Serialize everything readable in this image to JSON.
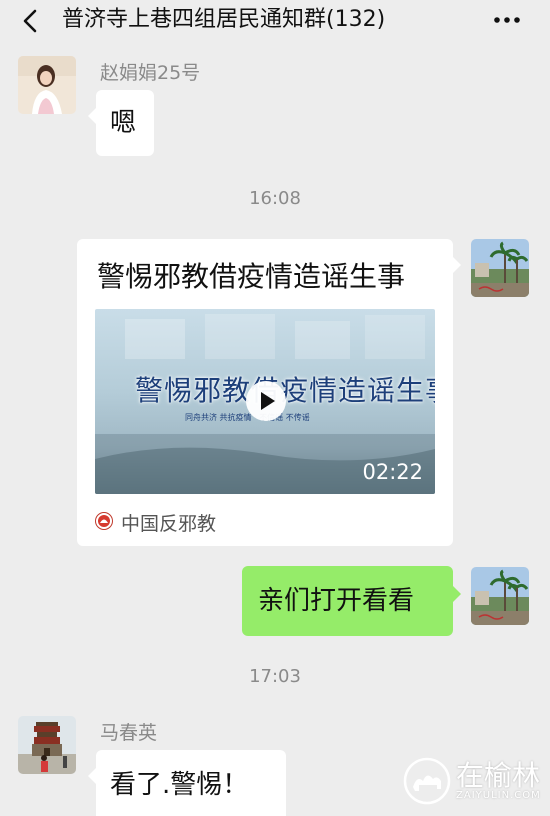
{
  "header": {
    "title": "普济寺上巷四组居民通知群(132)",
    "back_icon": "chevron-left-icon",
    "more_icon": "more-dots-icon"
  },
  "messages": [
    {
      "type": "text",
      "side": "left",
      "sender": "赵娟娟25号",
      "text": "嗯"
    },
    {
      "type": "time",
      "text": "16:08"
    },
    {
      "type": "card",
      "side": "right",
      "title": "警惕邪教借疫情造谣生事",
      "video": {
        "headline": "警惕邪教借疫情造谣生事",
        "subline": "同舟共济 共抗疫情 · 不信谣 不传谣",
        "duration": "02:22"
      },
      "source": "中国反邪教"
    },
    {
      "type": "text",
      "side": "right",
      "text": "亲们打开看看"
    },
    {
      "type": "time",
      "text": "17:03"
    },
    {
      "type": "text",
      "side": "left",
      "sender": "马春英",
      "text": "看了.警惕！"
    }
  ],
  "watermark": {
    "text": "在榆林",
    "url": "ZAIYULIN.COM"
  },
  "colors": {
    "background": "#ededed",
    "bubble_white": "#ffffff",
    "bubble_green": "#95ec69"
  }
}
